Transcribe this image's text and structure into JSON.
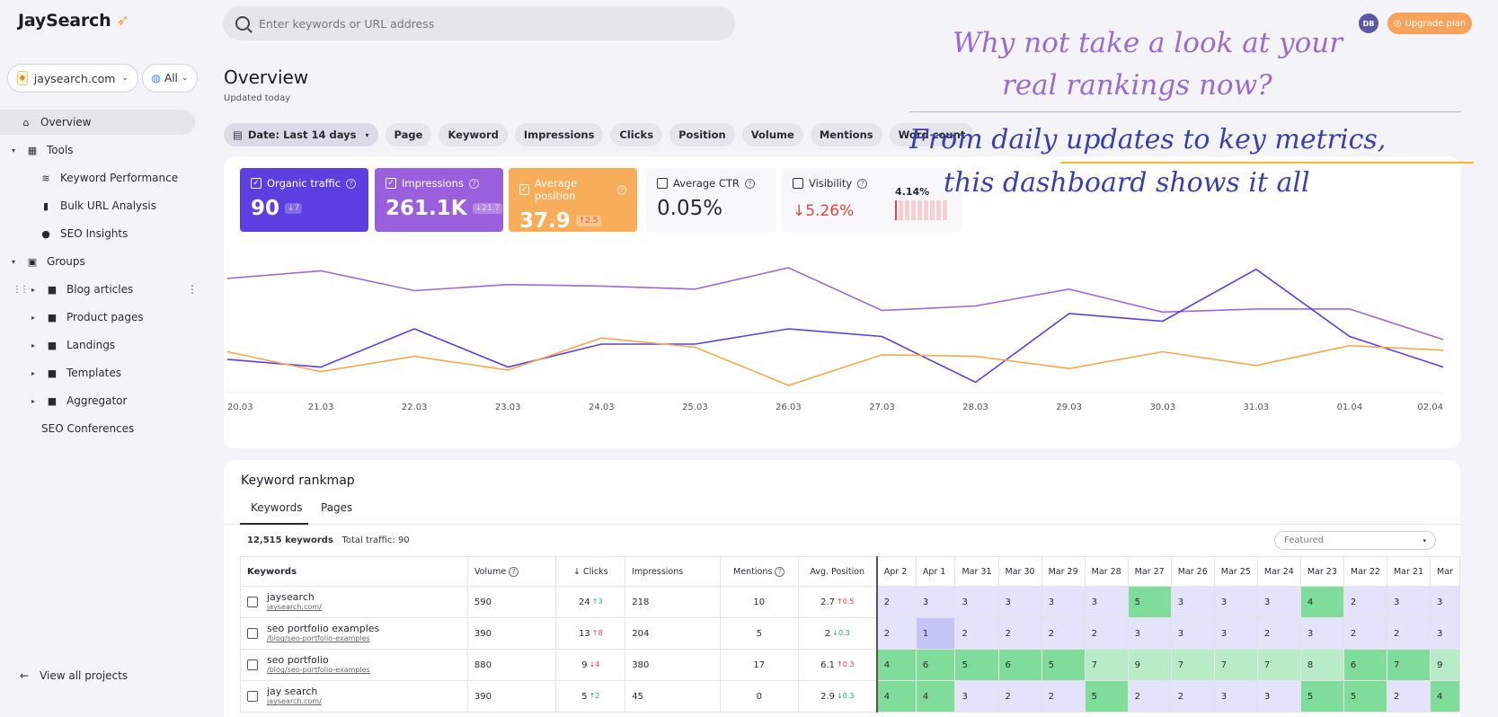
{
  "app": {
    "logo_text": "JaySearch"
  },
  "project": {
    "name": "jaysearch.com",
    "scope": "All"
  },
  "sidebar": {
    "items": [
      {
        "label": "Overview",
        "icon": "home-icon"
      },
      {
        "label": "Tools",
        "icon": "grid-icon"
      },
      {
        "label": "Keyword Performance",
        "icon": "signal-icon"
      },
      {
        "label": "Bulk URL Analysis",
        "icon": "bulk-icon"
      },
      {
        "label": "SEO Insights",
        "icon": "insight-icon"
      },
      {
        "label": "Groups",
        "icon": "groups-icon"
      },
      {
        "label": "Blog articles",
        "icon": "folder-icon"
      },
      {
        "label": "Product pages",
        "icon": "folder-icon"
      },
      {
        "label": "Landings",
        "icon": "folder-icon"
      },
      {
        "label": "Templates",
        "icon": "folder-icon"
      },
      {
        "label": "Aggregator",
        "icon": "folder-icon"
      },
      {
        "label": "SEO Conferences",
        "icon": ""
      }
    ],
    "view_all": "View all projects"
  },
  "search": {
    "placeholder": "Enter keywords or URL address"
  },
  "user": {
    "initials": "DB"
  },
  "upgrade": {
    "label": "Upgrade plan"
  },
  "overview": {
    "title": "Overview",
    "subtitle": "Updated today"
  },
  "filters": [
    "Date: Last 14 days",
    "Page",
    "Keyword",
    "Impressions",
    "Clicks",
    "Position",
    "Volume",
    "Mentions",
    "Word count"
  ],
  "annotation": {
    "line1": "Why not take a look at your",
    "line2": "real rankings now?",
    "line3": "From daily updates to key metrics,",
    "line4": "this dashboard shows it all"
  },
  "metrics": {
    "organic": {
      "label": "Organic traffic",
      "value": "90",
      "delta": "↓7",
      "checked": true
    },
    "impressions": {
      "label": "Impressions",
      "value": "261.1K",
      "delta": "↓21.7",
      "checked": true
    },
    "avg_position": {
      "label": "Average position",
      "value": "37.9",
      "delta": "↑2.5",
      "checked": true
    },
    "ctr": {
      "label": "Average CTR",
      "value": "0.05%",
      "checked": false
    },
    "visibility": {
      "label": "Visibility",
      "value": "↓5.26%",
      "bar_value": "4.14%",
      "checked": false
    }
  },
  "chart_data": {
    "type": "line",
    "x": [
      "20.03",
      "21.03",
      "22.03",
      "23.03",
      "24.03",
      "25.03",
      "26.03",
      "27.03",
      "28.03",
      "29.03",
      "30.03",
      "31.03",
      "01.04",
      "02.04"
    ],
    "series": [
      {
        "name": "Impressions",
        "color": "#9b6bd0",
        "values": [
          73,
          78,
          65,
          69,
          68,
          66,
          80,
          52,
          55,
          66,
          51,
          53,
          53,
          33
        ]
      },
      {
        "name": "Organic traffic",
        "color": "#5b3fe0",
        "values": [
          20,
          15,
          40,
          15,
          30,
          30,
          40,
          35,
          5,
          50,
          45,
          79,
          35,
          15
        ]
      },
      {
        "name": "Average position",
        "color": "#f2a94f",
        "values": [
          25,
          12,
          22,
          13,
          34,
          28,
          3,
          23,
          22,
          14,
          25,
          16,
          29,
          26
        ]
      }
    ],
    "ylim": [
      0,
      100
    ]
  },
  "rankmap": {
    "title": "Keyword rankmap",
    "tabs": [
      "Keywords",
      "Pages"
    ],
    "total_keywords": "12,515 keywords",
    "total_traffic": "Total traffic: 90",
    "sort_select": "Featured",
    "columns": {
      "keywords": "Keywords",
      "volume": "Volume",
      "clicks": "Clicks",
      "impressions": "Impressions",
      "mentions": "Mentions",
      "avg_position": "Avg. Position"
    },
    "dates": [
      "Apr 2",
      "Apr 1",
      "Mar 31",
      "Mar 30",
      "Mar 29",
      "Mar 28",
      "Mar 27",
      "Mar 26",
      "Mar 25",
      "Mar 24",
      "Mar 23",
      "Mar 22",
      "Mar 21",
      "Mar"
    ],
    "rows": [
      {
        "keyword": "jaysearch",
        "url": "jaysearch.com/",
        "volume": "590",
        "clicks": "24",
        "clicks_delta": "↑3",
        "clicks_dir": "down",
        "impressions": "218",
        "mentions": "10",
        "avg": "2.7",
        "avg_delta": "↑0.5",
        "avg_dir": "up",
        "heat": [
          "2",
          "3",
          "3",
          "3",
          "3",
          "3",
          "5",
          "3",
          "3",
          "3",
          "4",
          "2",
          "3",
          "3"
        ],
        "heat_levels": [
          "low",
          "low",
          "low",
          "low",
          "low",
          "low",
          "high",
          "low",
          "low",
          "low",
          "high",
          "low",
          "low",
          "low"
        ]
      },
      {
        "keyword": "seo portfolio examples",
        "url": "/blog/seo-portfolio-examples",
        "volume": "390",
        "clicks": "13",
        "clicks_delta": "↑8",
        "clicks_dir": "up",
        "impressions": "204",
        "mentions": "5",
        "avg": "2",
        "avg_delta": "↓0.3",
        "avg_dir": "down",
        "heat": [
          "2",
          "1",
          "2",
          "2",
          "2",
          "2",
          "3",
          "3",
          "3",
          "2",
          "3",
          "2",
          "2",
          "3"
        ],
        "heat_levels": [
          "low",
          "top",
          "low",
          "low",
          "low",
          "low",
          "low",
          "low",
          "low",
          "low",
          "low",
          "low",
          "low",
          "low"
        ]
      },
      {
        "keyword": "seo portfolio",
        "url": "/blog/seo-portfolio-examples",
        "volume": "880",
        "clicks": "9",
        "clicks_delta": "↓4",
        "clicks_dir": "up",
        "impressions": "380",
        "mentions": "17",
        "avg": "6.1",
        "avg_delta": "↑0.3",
        "avg_dir": "up",
        "heat": [
          "4",
          "6",
          "5",
          "6",
          "5",
          "7",
          "9",
          "7",
          "7",
          "7",
          "8",
          "6",
          "7",
          "9"
        ],
        "heat_levels": [
          "high",
          "high",
          "high",
          "high",
          "high",
          "mid",
          "mid",
          "mid",
          "mid",
          "mid",
          "mid",
          "high",
          "high",
          "mid"
        ]
      },
      {
        "keyword": "jay search",
        "url": "jaysearch.com/",
        "volume": "390",
        "clicks": "5",
        "clicks_delta": "↑2",
        "clicks_dir": "down",
        "impressions": "45",
        "mentions": "0",
        "avg": "2.9",
        "avg_delta": "↓0.3",
        "avg_dir": "down",
        "heat": [
          "4",
          "4",
          "3",
          "2",
          "2",
          "5",
          "2",
          "2",
          "3",
          "3",
          "5",
          "5",
          "2",
          "4"
        ],
        "heat_levels": [
          "high",
          "high",
          "low",
          "low",
          "low",
          "high",
          "low",
          "low",
          "low",
          "low",
          "high",
          "high",
          "low",
          "high"
        ]
      }
    ]
  }
}
